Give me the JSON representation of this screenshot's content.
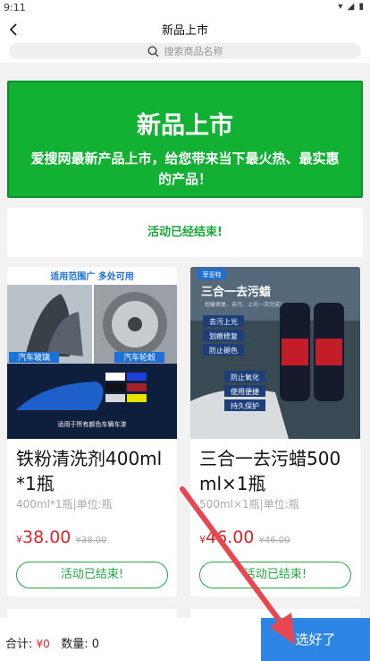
{
  "status_bar": {
    "time": "9:11"
  },
  "header": {
    "title": "新品上市",
    "search_placeholder": "搜索商品名称"
  },
  "banner": {
    "title": "新品上市",
    "subtitle": "爱搜网最新产品上市，给您带来当下最火热、最实惠的产品！"
  },
  "notice": {
    "text": "活动已经结束!"
  },
  "products": [
    {
      "name": "铁粉清洗剂400ml*1瓶",
      "spec": "400ml*1瓶|单位:瓶",
      "currency": "¥",
      "price": "38.00",
      "old_price": "¥38.00",
      "button": "活动已结束!",
      "image_text": {
        "top": "适用范围广 多处可用",
        "label_glass": "汽车玻璃",
        "label_wheel": "汽车轮毂",
        "bottom": "适用于所有颜色车辆车漆"
      }
    },
    {
      "name": "三合一去污蜡500ml×1瓶",
      "spec": "500ml×1瓶|单位:瓶",
      "currency": "¥",
      "price": "46.00",
      "old_price": "¥46.00",
      "button": "活动已结束!",
      "image_text": {
        "brand": "菲亚特",
        "title": "三合一去污蜡",
        "f1": "去污上光",
        "f2": "划痕修复",
        "f3": "防止褪色",
        "f4": "防止氧化",
        "f5": "使用便捷",
        "f6": "持久保护",
        "sub": "划痕修复、去污、上光一次完成！"
      }
    }
  ],
  "footer": {
    "total_label": "合计:",
    "total_value": "¥0",
    "count_label": "数量:",
    "count_value": "0",
    "confirm_label": "选好了"
  },
  "colors": {
    "green": "#12b033",
    "red": "#e4222b",
    "blue": "#2d86e6"
  }
}
